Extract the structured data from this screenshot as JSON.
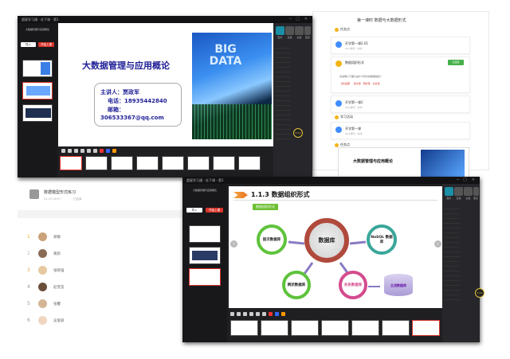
{
  "window1": {
    "title": "超星学习通 - 在下课 - 第1",
    "course_label": "大数据管理与应用概论",
    "btn_left": "导入",
    "btn_right": "开始上课",
    "slide_title": "大数据管理与应用概论",
    "lecturer": "主讲人：贾政军",
    "phone": "电话：18935442840",
    "email_label": "邮箱：",
    "email": "306533367@qq.com",
    "bigdata_text": "BIG DATA",
    "timer": "5:12",
    "right_tabs": [
      "图片",
      "直播",
      "白板",
      "更多"
    ]
  },
  "chapter": {
    "title": "第一课时 数据与大数据形式",
    "section1": "任务点",
    "task1_title": "开学第一课2.01",
    "task1_meta": "21人参与 · 共享",
    "task2_title": "数据组织形式",
    "task2_status": "已结束",
    "task2_question": "请说明以下图片是什么形式的数据组织？",
    "task2_options": "【多选题】 · 层次型 · 网状型 · 关系型",
    "task3_title": "开学第一课2",
    "task3_meta": "20人参与 · 共享",
    "section2": "学习活动",
    "task4_title": "开学第一课",
    "task4_meta": "20人参与 · 共享",
    "section3": "任务点",
    "slide_title": "大数据管理与应用概论"
  },
  "activity": {
    "title": "数据模型形式练习",
    "meta": "01-15 08:57",
    "status": "已结束",
    "students": [
      {
        "rank": "1",
        "name": "郑静"
      },
      {
        "rank": "2",
        "name": "黄新"
      },
      {
        "rank": "3",
        "name": "张晓强"
      },
      {
        "rank": "4",
        "name": "赵雪莹"
      },
      {
        "rank": "5",
        "name": "张馨"
      },
      {
        "rank": "6",
        "name": "吴俊丽"
      }
    ]
  },
  "window2": {
    "title": "超星学习通 - 在下课 - 第1",
    "course_label": "大数据管理与应用概论",
    "btn_left": "导入",
    "btn_right": "开始上课",
    "slide_heading": "1.1.3  数据组织形式",
    "slide_tag": "数据组织形式",
    "center_node": "数据库",
    "node_hier": "层次数据库",
    "node_nosql": "NoSQL 数据库",
    "node_net": "网状数据库",
    "node_rel": "关系数据库",
    "node_mainstream": "主流数据库",
    "timer": "5:12",
    "right_tabs": [
      "图片",
      "直播",
      "白板",
      "更多"
    ]
  },
  "colors": {
    "accent_red": "#d9342b",
    "accent_teal": "#1a8fa6",
    "task_green": "#47b04b",
    "task_yellow": "#f3b418"
  }
}
